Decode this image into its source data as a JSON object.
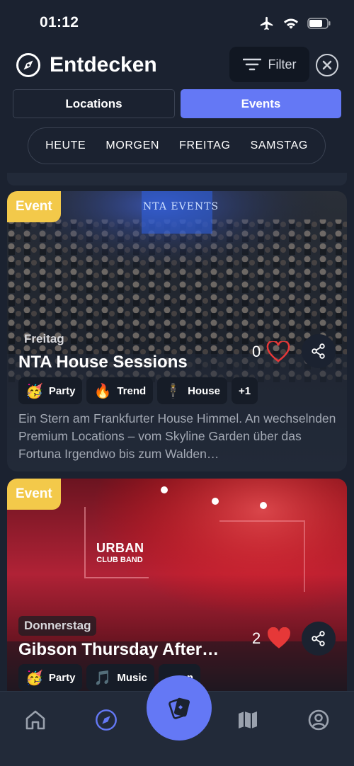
{
  "status_bar": {
    "time": "01:12"
  },
  "header": {
    "title": "Entdecken",
    "filter_label": "Filter"
  },
  "segments": {
    "locations": "Locations",
    "events": "Events",
    "active": "Events"
  },
  "days": [
    "HEUTE",
    "MORGEN",
    "FREITAG",
    "SAMSTAG"
  ],
  "cards": [
    {
      "badge": "Event",
      "day": "Freitag",
      "title": "NTA House Sessions",
      "likes": "0",
      "liked": false,
      "image_text": "NTA EVENTS",
      "tags": [
        {
          "emoji": "🥳",
          "label": "Party"
        },
        {
          "emoji": "🔥",
          "label": "Trend"
        },
        {
          "emoji": "🕴",
          "label": "House"
        },
        {
          "emoji": "",
          "label": "+1"
        }
      ],
      "description": "Ein Stern am Frankfurter House Himmel. An wechselnden Premium Locations – vom Skyline Garden über das Fortuna Irgendwo bis zum Walden…"
    },
    {
      "badge": "Event",
      "day": "Donnerstag",
      "title": "Gibson Thursday After…",
      "likes": "2",
      "liked": true,
      "image_text_1": "URBAN",
      "image_text_2": "CLUB BAND",
      "tags": [
        {
          "emoji": "🥳",
          "label": "Party"
        },
        {
          "emoji": "🎵",
          "label": "Music"
        },
        {
          "emoji": "",
          "label": "n"
        }
      ]
    }
  ],
  "colors": {
    "accent": "#6478f5",
    "badge": "#f3c94a",
    "background": "#1b2230",
    "heart_red": "#e63838"
  }
}
